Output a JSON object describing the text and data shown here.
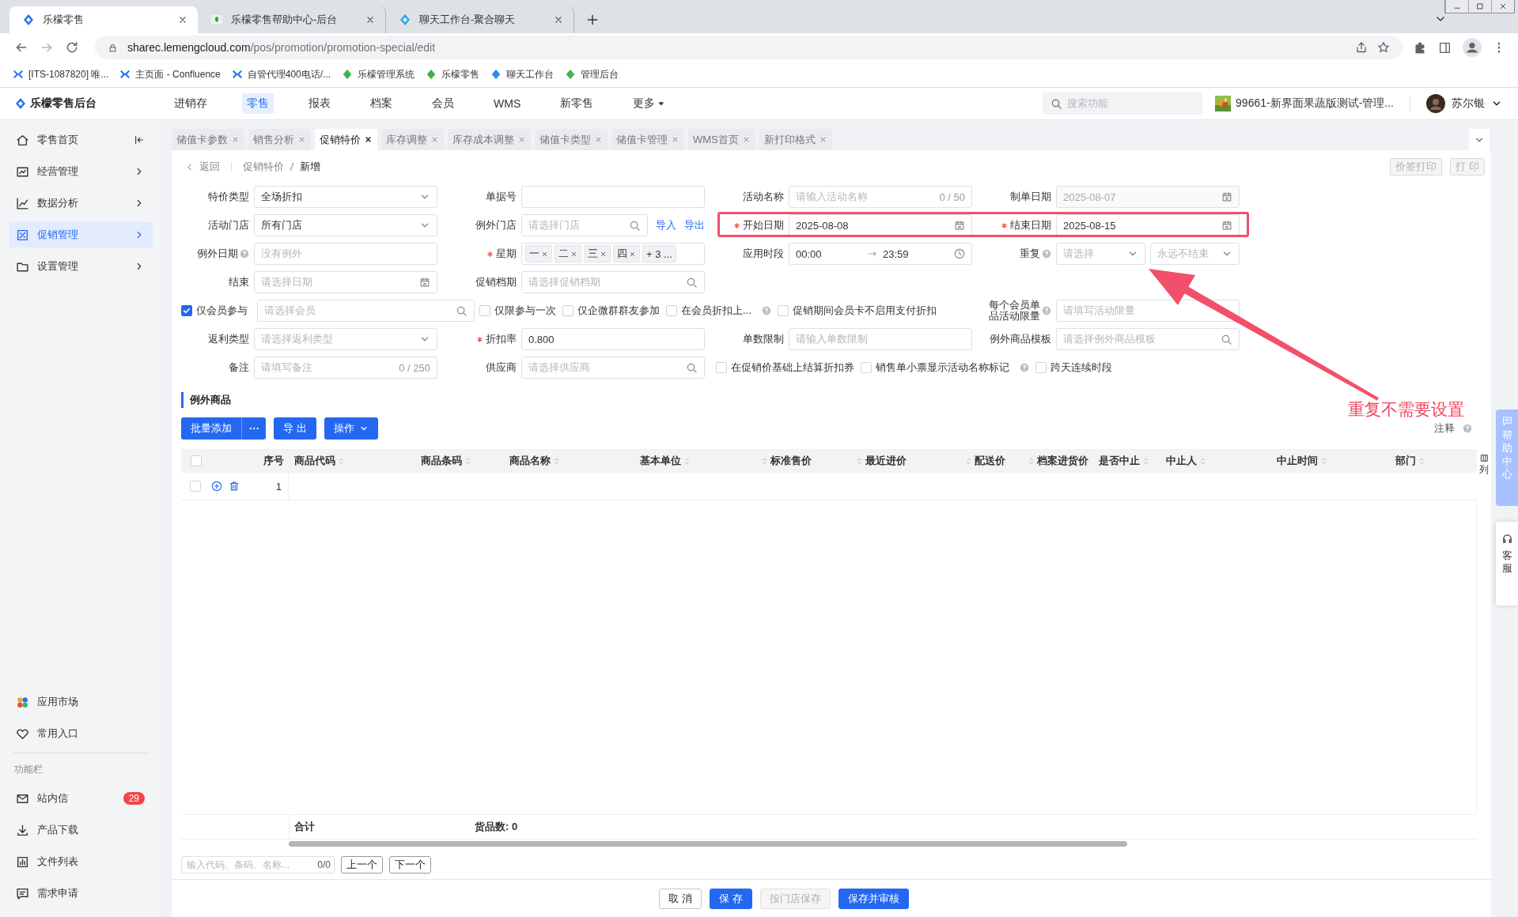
{
  "browser": {
    "tabs": [
      {
        "title": "乐檬零售",
        "selected": true
      },
      {
        "title": "乐檬零售帮助中心-后台",
        "selected": false
      },
      {
        "title": "聊天工作台-聚合聊天",
        "selected": false
      }
    ],
    "url_host": "sharec.lemengcloud.com",
    "url_path": "/pos/promotion/promotion-special/edit",
    "bookmarks": [
      "[ITS-1087820] 唯...",
      "主页面 - Confluence",
      "自管代理400电话/...",
      "乐檬管理系统",
      "乐檬零售",
      "聊天工作台",
      "管理后台"
    ]
  },
  "header": {
    "logo": "乐檬零售后台",
    "nav": [
      {
        "label": "进销存",
        "selected": false
      },
      {
        "label": "零售",
        "selected": true
      },
      {
        "label": "报表",
        "selected": false
      },
      {
        "label": "档案",
        "selected": false
      },
      {
        "label": "会员",
        "selected": false
      },
      {
        "label": "WMS",
        "selected": false
      },
      {
        "label": "新零售",
        "selected": false
      },
      {
        "label": "更多",
        "selected": false
      }
    ],
    "search_placeholder": "搜索功能",
    "store": "99661-新界面果蔬版测试-管理...",
    "user": "苏尔银"
  },
  "sidebar": {
    "items": [
      {
        "label": "零售首页",
        "selected": false
      },
      {
        "label": "经营管理",
        "selected": false
      },
      {
        "label": "数据分析",
        "selected": false
      },
      {
        "label": "促销管理",
        "selected": true
      },
      {
        "label": "设置管理",
        "selected": false
      }
    ],
    "apps": [
      "应用市场",
      "常用入口"
    ],
    "section": "功能栏",
    "tools": [
      {
        "label": "站内信",
        "badge": "29"
      },
      {
        "label": "产品下载"
      },
      {
        "label": "文件列表"
      },
      {
        "label": "需求申请"
      }
    ]
  },
  "page_tabs": [
    {
      "label": "储值卡参数",
      "selected": false
    },
    {
      "label": "销售分析",
      "selected": false
    },
    {
      "label": "促销特价",
      "selected": true
    },
    {
      "label": "库存调整",
      "selected": false
    },
    {
      "label": "库存成本调整",
      "selected": false
    },
    {
      "label": "储值卡类型",
      "selected": false
    },
    {
      "label": "储值卡管理",
      "selected": false
    },
    {
      "label": "WMS首页",
      "selected": false
    },
    {
      "label": "新打印格式",
      "selected": false
    }
  ],
  "breadcrumb": {
    "back": "返回",
    "path": [
      "促销特价",
      "新增"
    ]
  },
  "print_buttons": [
    "价签打印",
    "打 印"
  ],
  "form": [
    [
      {
        "kind": "field",
        "label": "特价类型",
        "required": false,
        "help": false,
        "controls": [
          {
            "kind": "select",
            "value": "全场折扣"
          }
        ]
      },
      {
        "kind": "field",
        "label": "单据号",
        "required": false,
        "help": false,
        "controls": [
          {
            "kind": "input"
          }
        ]
      },
      {
        "kind": "field",
        "label": "活动名称",
        "required": false,
        "help": false,
        "controls": [
          {
            "kind": "input",
            "placeholder": "请输入活动名称",
            "counter": "0 / 50"
          }
        ]
      },
      {
        "kind": "field",
        "label": "制单日期",
        "required": false,
        "help": false,
        "controls": [
          {
            "kind": "date",
            "value": "2025-08-07",
            "disabled": true
          }
        ]
      }
    ],
    [
      {
        "kind": "field",
        "label": "活动门店",
        "required": false,
        "help": false,
        "controls": [
          {
            "kind": "select",
            "value": "所有门店"
          }
        ]
      },
      {
        "kind": "field",
        "label": "例外门店",
        "required": false,
        "help": false,
        "controls": [
          {
            "kind": "search",
            "placeholder": "请选择门店"
          }
        ],
        "links": [
          "导入",
          "导出"
        ]
      },
      {
        "kind": "field",
        "label": "开始日期",
        "required": true,
        "help": false,
        "controls": [
          {
            "kind": "date",
            "value": "2025-08-08",
            "disabled": false
          }
        ]
      },
      {
        "kind": "field",
        "label": "结束日期",
        "required": true,
        "help": false,
        "controls": [
          {
            "kind": "date",
            "value": "2025-08-15",
            "disabled": false
          }
        ]
      }
    ],
    [
      {
        "kind": "field",
        "label": "例外日期",
        "required": false,
        "help": true,
        "controls": [
          {
            "kind": "input",
            "placeholder": "没有例外"
          }
        ]
      },
      {
        "kind": "field",
        "label": "星期",
        "required": true,
        "help": false,
        "controls": [
          {
            "kind": "tags",
            "tags": [
              "一",
              "二",
              "三",
              "四"
            ],
            "more": "+ 3 ..."
          }
        ]
      },
      {
        "kind": "field",
        "label": "应用时段",
        "required": false,
        "help": false,
        "controls": [
          {
            "kind": "time_range",
            "from": "00:00",
            "to": "23:59"
          }
        ]
      },
      {
        "kind": "field",
        "label": "重复",
        "required": false,
        "help": true,
        "controls": [
          {
            "kind": "select",
            "placeholder": "请选择"
          },
          {
            "kind": "select",
            "placeholder": "永远不结束"
          }
        ]
      }
    ],
    [
      {
        "kind": "field",
        "label": "结束",
        "required": false,
        "help": false,
        "controls": [
          {
            "kind": "date",
            "placeholder": "请选择日期",
            "disabled": false
          }
        ]
      },
      {
        "kind": "field",
        "label": "促销档期",
        "required": false,
        "help": false,
        "controls": [
          {
            "kind": "search",
            "placeholder": "请选择促销档期"
          }
        ]
      }
    ],
    [
      {
        "kind": "check_field",
        "label": "仅会员参与",
        "checked": true,
        "controls": [
          {
            "kind": "search",
            "placeholder": "请选择会员"
          }
        ]
      },
      {
        "kind": "checkboxes",
        "items": [
          {
            "label": "仅限参与一次",
            "checked": false,
            "help": false
          },
          {
            "label": "仅企微群群友参加",
            "checked": false,
            "help": false
          },
          {
            "label": "在会员折扣上...",
            "checked": false,
            "help": true
          },
          {
            "label": "促销期间会员卡不启用支付折扣",
            "checked": false,
            "help": false
          }
        ]
      },
      {
        "kind": "field",
        "label": "每个会员单品活动限量",
        "required": false,
        "help": true,
        "controls": [
          {
            "kind": "input",
            "placeholder": "请填写活动限量"
          }
        ]
      }
    ],
    [
      {
        "kind": "field",
        "label": "返利类型",
        "required": false,
        "help": false,
        "controls": [
          {
            "kind": "select",
            "placeholder": "请选择返利类型"
          }
        ]
      },
      {
        "kind": "field",
        "label": "折扣率",
        "required": true,
        "help": false,
        "controls": [
          {
            "kind": "input",
            "value": "0.800"
          }
        ]
      },
      {
        "kind": "field",
        "label": "单数限制",
        "required": false,
        "help": false,
        "controls": [
          {
            "kind": "input",
            "placeholder": "请输入单数限制"
          }
        ]
      },
      {
        "kind": "field",
        "label": "例外商品模板",
        "required": false,
        "help": false,
        "controls": [
          {
            "kind": "search",
            "placeholder": "请选择例外商品模板"
          }
        ]
      }
    ],
    [
      {
        "kind": "field",
        "label": "备注",
        "required": false,
        "help": false,
        "controls": [
          {
            "kind": "input",
            "placeholder": "请填写备注",
            "counter": "0 / 250"
          }
        ]
      },
      {
        "kind": "field",
        "label": "供应商",
        "required": false,
        "help": false,
        "controls": [
          {
            "kind": "search",
            "placeholder": "请选择供应商"
          }
        ]
      },
      {
        "kind": "checkboxes",
        "items": [
          {
            "label": "在促销价基础上结算折扣券",
            "checked": false,
            "help": false
          },
          {
            "label": "销售单小票显示活动名称标记",
            "checked": false,
            "help": true
          },
          {
            "label": "跨天连续时段",
            "checked": false,
            "help": false
          }
        ]
      }
    ]
  ],
  "annotation": {
    "text": "重复不需要设置"
  },
  "section_title": "例外商品",
  "toolbar": [
    {
      "label": "批量添加",
      "kind": "split"
    },
    {
      "label": "导 出",
      "kind": "plain"
    },
    {
      "label": "操作",
      "kind": "menu"
    }
  ],
  "note": "注释",
  "table": {
    "header_checked": false,
    "columns": [
      {
        "label": "序号",
        "sortable": false,
        "numeric": true
      },
      {
        "label": "商品代码",
        "sortable": true,
        "numeric": false
      },
      {
        "label": "商品条码",
        "sortable": true,
        "numeric": false
      },
      {
        "label": "商品名称",
        "sortable": true,
        "numeric": false
      },
      {
        "label": "基本单位",
        "sortable": true,
        "numeric": false
      },
      {
        "label": "标准售价",
        "sortable": true,
        "numeric": true
      },
      {
        "label": "最近进价",
        "sortable": true,
        "numeric": true
      },
      {
        "label": "配送价",
        "sortable": true,
        "numeric": true
      },
      {
        "label": "档案进货价",
        "sortable": true,
        "numeric": true
      },
      {
        "label": "是否中止",
        "sortable": true,
        "numeric": false
      },
      {
        "label": "中止人",
        "sortable": true,
        "numeric": false
      },
      {
        "label": "中止时间",
        "sortable": true,
        "numeric": false
      },
      {
        "label": "部门",
        "sortable": true,
        "numeric": false
      }
    ],
    "settings": "列",
    "rows": [
      {
        "seq": "1",
        "checked": false
      }
    ],
    "summary": {
      "label": "合计",
      "count": "货品数: 0"
    }
  },
  "finder": {
    "placeholder": "输入代码、条码、名称...",
    "count": "0/0",
    "prev": "上一个",
    "next": "下一个"
  },
  "footer_buttons": [
    {
      "label": "取 消",
      "kind": "default"
    },
    {
      "label": "保 存",
      "kind": "primary"
    },
    {
      "label": "按门店保存",
      "kind": "disabled"
    },
    {
      "label": "保存并审核",
      "kind": "primary"
    }
  ],
  "float": {
    "help": "帮助中心",
    "service": "客服"
  }
}
